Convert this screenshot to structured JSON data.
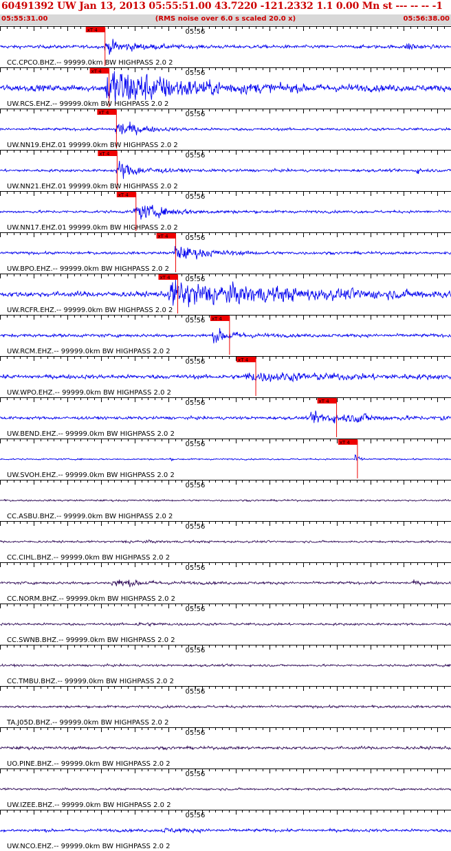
{
  "header": {
    "title": "60491392 UW Jan 13, 2013 05:55:51.00   43.7220 -121.2332  1.1 0.00 Mn st --- -- --  -1",
    "start_time": "05:55:31.00",
    "note": "(RMS noise over 6.0 s scaled 20.0 x)",
    "end_time": "05:56:38.00"
  },
  "colors": {
    "header_text": "#cc0000",
    "subheader_bg": "#d8d8d8",
    "trace_blue": "#0000ee",
    "trace_purple": "#33105a",
    "pick_box": "#ee0000",
    "axis": "#000000"
  },
  "chart_data": {
    "type": "line",
    "title": "60491392 UW Jan 13, 2013 05:55:51.00   43.7220 -121.2332  1.1 0.00 Mn st --- -- --  -1",
    "xlabel": "",
    "ylabel": "",
    "x_start": "05:55:31.00",
    "x_end": "05:56:38.00",
    "x_range_seconds": [
      0,
      67
    ],
    "minute_label": "05:56",
    "minute_mark_seconds": 29,
    "grid": false,
    "pick_label": "xT 4",
    "series": [
      {
        "name": "CC.CPCO.BHZ.-- 99999.0km BW  HIGHPASS  2.0  2",
        "color": "#0000ee",
        "noise": 0.22,
        "pick_s": 15.6,
        "events": [
          {
            "t": 15.4,
            "amp": 1.0,
            "dur": 9
          },
          {
            "t": 60.2,
            "amp": 0.9,
            "dur": 2.5
          }
        ]
      },
      {
        "name": "UW.RCS.EHZ.-- 99999.0km BW  HIGHPASS  2.0  2",
        "color": "#0000ee",
        "noise": 0.42,
        "pick_s": 16.2,
        "events": [
          {
            "t": 15.6,
            "amp": 3.0,
            "dur": 22
          }
        ]
      },
      {
        "name": "UW.NN19.EHZ.01 99999.0km BW  HIGHPASS  2.0  2",
        "color": "#0000ee",
        "noise": 0.18,
        "pick_s": 17.3,
        "events": [
          {
            "t": 17.0,
            "amp": 1.6,
            "dur": 6
          }
        ]
      },
      {
        "name": "UW.NN21.EHZ.01 99999.0km BW  HIGHPASS  2.0  2",
        "color": "#0000ee",
        "noise": 0.18,
        "pick_s": 17.4,
        "events": [
          {
            "t": 17.2,
            "amp": 1.4,
            "dur": 7
          },
          {
            "t": 61.5,
            "amp": 0.5,
            "dur": 2
          }
        ]
      },
      {
        "name": "UW.NN17.EHZ.01 99999.0km BW  HIGHPASS  2.0  2",
        "color": "#0000ee",
        "noise": 0.18,
        "pick_s": 20.2,
        "events": [
          {
            "t": 19.8,
            "amp": 1.2,
            "dur": 10
          }
        ]
      },
      {
        "name": "UW.BPO.EHZ.-- 99999.0km BW  HIGHPASS  2.0  2",
        "color": "#0000ee",
        "noise": 0.18,
        "pick_s": 26.1,
        "events": [
          {
            "t": 25.6,
            "amp": 1.1,
            "dur": 10
          }
        ]
      },
      {
        "name": "UW.RCFR.EHZ.-- 99999.0km BW  HIGHPASS  2.0  2",
        "color": "#0000ee",
        "noise": 0.35,
        "pick_s": 26.4,
        "events": [
          {
            "t": 24.8,
            "amp": 1.8,
            "dur": 40
          }
        ]
      },
      {
        "name": "UW.RCM.EHZ.-- 99999.0km BW  HIGHPASS  2.0  2",
        "color": "#0000ee",
        "noise": 0.22,
        "pick_s": 34.1,
        "events": [
          {
            "t": 31.5,
            "amp": 1.1,
            "dur": 6
          }
        ]
      },
      {
        "name": "UW.WPO.EHZ.-- 99999.0km BW  HIGHPASS  2.0  2",
        "color": "#0000ee",
        "noise": 0.28,
        "pick_s": 38.0,
        "events": [
          {
            "t": 36.3,
            "amp": 0.55,
            "dur": 31
          }
        ]
      },
      {
        "name": "UW.BEND.EHZ.-- 99999.0km BW  HIGHPASS  2.0  2",
        "color": "#0000ee",
        "noise": 0.2,
        "pick_s": 50.0,
        "events": [
          {
            "t": 46.0,
            "amp": 0.8,
            "dur": 16
          },
          {
            "t": 53.0,
            "amp": 0.9,
            "dur": 2
          },
          {
            "t": 65.0,
            "amp": 0.6,
            "dur": 2
          }
        ]
      },
      {
        "name": "UW.SVOH.EHZ.-- 99999.0km BW  HIGHPASS  2.0  2",
        "color": "#0000ee",
        "noise": 0.1,
        "pick_s": 53.1,
        "events": [
          {
            "t": 52.5,
            "amp": 0.9,
            "dur": 1.5
          },
          {
            "t": 25.0,
            "amp": 0.5,
            "dur": 0.6
          }
        ]
      },
      {
        "name": "CC.ASBU.BHZ.-- 99999.0km BW  HIGHPASS  2.0  2",
        "color": "#33105a",
        "noise": 0.12,
        "pick_s": null,
        "events": []
      },
      {
        "name": "CC.CIHL.BHZ.-- 99999.0km BW  HIGHPASS  2.0  2",
        "color": "#33105a",
        "noise": 0.14,
        "pick_s": null,
        "events": [
          {
            "t": 18.0,
            "amp": 0.12,
            "dur": 12
          }
        ]
      },
      {
        "name": "CC.NORM.BHZ.-- 99999.0km BW  HIGHPASS  2.0  2",
        "color": "#33105a",
        "noise": 0.18,
        "pick_s": null,
        "events": [
          {
            "t": 16.5,
            "amp": 0.55,
            "dur": 9
          },
          {
            "t": 61.0,
            "amp": 0.35,
            "dur": 2
          }
        ]
      },
      {
        "name": "CC.SWNB.BHZ.-- 99999.0km BW  HIGHPASS  2.0  2",
        "color": "#33105a",
        "noise": 0.16,
        "pick_s": null,
        "events": [
          {
            "t": 20.0,
            "amp": 0.2,
            "dur": 6
          }
        ]
      },
      {
        "name": "CC.TMBU.BHZ.-- 99999.0km BW  HIGHPASS  2.0  2",
        "color": "#33105a",
        "noise": 0.15,
        "pick_s": null,
        "events": []
      },
      {
        "name": "TA.J05D.BHZ.-- 99999.0km BW  HIGHPASS  2.0  2",
        "color": "#33105a",
        "noise": 0.17,
        "pick_s": null,
        "events": []
      },
      {
        "name": "UO.PINE.BHZ.-- 99999.0km BW  HIGHPASS  2.0  2",
        "color": "#33105a",
        "noise": 0.2,
        "pick_s": null,
        "events": []
      },
      {
        "name": "UW.IZEE.BHZ.-- 99999.0km BW  HIGHPASS  2.0  2",
        "color": "#33105a",
        "noise": 0.15,
        "pick_s": null,
        "events": []
      },
      {
        "name": "UW.NCO.EHZ.-- 99999.0km BW  HIGHPASS  2.0  2",
        "color": "#0000ee",
        "noise": 0.2,
        "pick_s": null,
        "events": [
          {
            "t": 24.0,
            "amp": 0.25,
            "dur": 8
          }
        ]
      }
    ]
  }
}
